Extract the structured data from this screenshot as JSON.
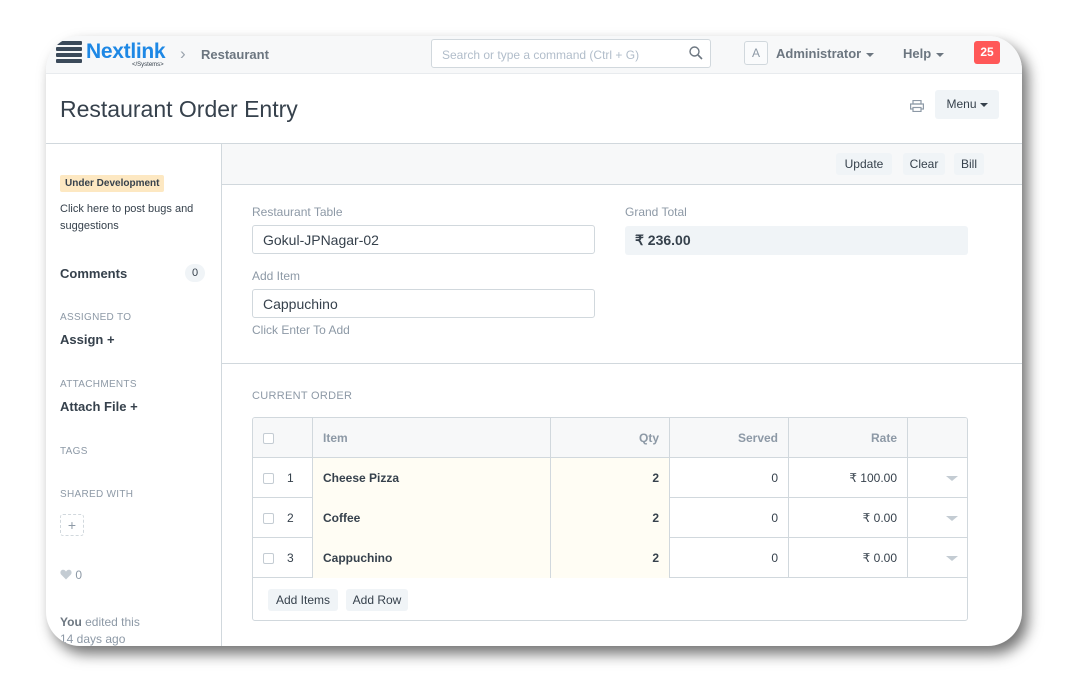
{
  "navbar": {
    "brand": "Nextlink",
    "brand_sub": "</Systems>",
    "breadcrumb": "Restaurant",
    "search_placeholder": "Search or type a command (Ctrl + G)",
    "avatar_letter": "A",
    "user": "Administrator",
    "help": "Help",
    "notifications": "25"
  },
  "page": {
    "title": "Restaurant Order Entry",
    "menu_label": "Menu"
  },
  "sidebar": {
    "status_badge": "Under Development",
    "bug_text": "Click here to post bugs and suggestions",
    "comments_label": "Comments",
    "comments_count": "0",
    "assigned_to_label": "ASSIGNED TO",
    "assign_action": "Assign +",
    "attachments_label": "ATTACHMENTS",
    "attach_action": "Attach File +",
    "tags_label": "TAGS",
    "shared_with_label": "SHARED WITH",
    "add_share": "+",
    "likes": "0",
    "edited_by": "You",
    "edited_text": "edited this",
    "edited_when": "14 days ago"
  },
  "actions": {
    "update": "Update",
    "clear": "Clear",
    "bill": "Bill"
  },
  "form": {
    "table_label": "Restaurant Table",
    "table_value": "Gokul-JPNagar-02",
    "add_item_label": "Add Item",
    "add_item_value": "Cappuchino",
    "add_item_hint": "Click Enter To Add",
    "grand_total_label": "Grand Total",
    "grand_total_value": "₹ 236.00"
  },
  "order": {
    "section_label": "CURRENT ORDER",
    "columns": {
      "item": "Item",
      "qty": "Qty",
      "served": "Served",
      "rate": "Rate"
    },
    "rows": [
      {
        "idx": "1",
        "item": "Cheese Pizza",
        "qty": "2",
        "served": "0",
        "rate": "₹ 100.00"
      },
      {
        "idx": "2",
        "item": "Coffee",
        "qty": "2",
        "served": "0",
        "rate": "₹ 0.00"
      },
      {
        "idx": "3",
        "item": "Cappuchino",
        "qty": "2",
        "served": "0",
        "rate": "₹ 0.00"
      }
    ],
    "add_items_label": "Add Items",
    "add_row_label": "Add Row"
  },
  "colors": {
    "brand": "#1e88e5",
    "notification": "#ff5858",
    "dev_badge": "#fde8c2"
  }
}
